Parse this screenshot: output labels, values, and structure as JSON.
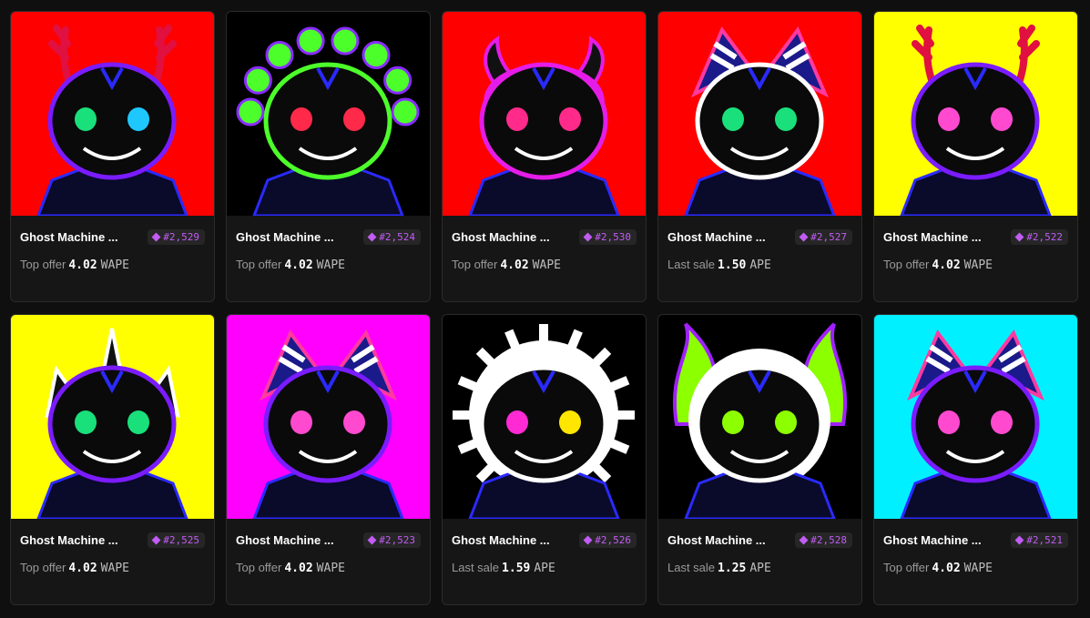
{
  "cards": [
    {
      "name": "Ghost Machine ...",
      "token": "#2,529",
      "label": "Top offer",
      "price": "4.02",
      "currency": "WAPE",
      "bg": "#ff0000",
      "eye": "#19e07a",
      "eye2": "#1ec8ff",
      "accent": "#7a1cff",
      "horn": "antlers"
    },
    {
      "name": "Ghost Machine ...",
      "token": "#2,524",
      "label": "Top offer",
      "price": "4.02",
      "currency": "WAPE",
      "bg": "#000000",
      "eye": "#ff2a4a",
      "eye2": "#ff2a4a",
      "accent": "#4dff2a",
      "horn": "tendrils"
    },
    {
      "name": "Ghost Machine ...",
      "token": "#2,530",
      "label": "Top offer",
      "price": "4.02",
      "currency": "WAPE",
      "bg": "#ff0000",
      "eye": "#ff2a8a",
      "eye2": "#ff2a8a",
      "accent": "#e51ce8",
      "horn": "horns"
    },
    {
      "name": "Ghost Machine ...",
      "token": "#2,527",
      "label": "Last sale",
      "price": "1.50",
      "currency": "APE",
      "bg": "#ff0000",
      "eye": "#19e07a",
      "eye2": "#19e07a",
      "accent": "#ffffff",
      "horn": "fins"
    },
    {
      "name": "Ghost Machine ...",
      "token": "#2,522",
      "label": "Top offer",
      "price": "4.02",
      "currency": "WAPE",
      "bg": "#ffff00",
      "eye": "#ff4ad0",
      "eye2": "#ff4ad0",
      "accent": "#7a1cff",
      "horn": "antlers"
    },
    {
      "name": "Ghost Machine ...",
      "token": "#2,525",
      "label": "Top offer",
      "price": "4.02",
      "currency": "WAPE",
      "bg": "#ffff00",
      "eye": "#19e07a",
      "eye2": "#19e07a",
      "accent": "#7a1cff",
      "horn": "spikes"
    },
    {
      "name": "Ghost Machine ...",
      "token": "#2,523",
      "label": "Top offer",
      "price": "4.02",
      "currency": "WAPE",
      "bg": "#ff00ff",
      "eye": "#ff4ad0",
      "eye2": "#ff4ad0",
      "accent": "#7a1cff",
      "horn": "fins"
    },
    {
      "name": "Ghost Machine ...",
      "token": "#2,526",
      "label": "Last sale",
      "price": "1.59",
      "currency": "APE",
      "bg": "#000000",
      "eye": "#ff2ad4",
      "eye2": "#ffe600",
      "accent": "#ffffff",
      "horn": "halo"
    },
    {
      "name": "Ghost Machine ...",
      "token": "#2,528",
      "label": "Last sale",
      "price": "1.25",
      "currency": "APE",
      "bg": "#000000",
      "eye": "#8cff00",
      "eye2": "#8cff00",
      "accent": "#ffffff",
      "horn": "flames"
    },
    {
      "name": "Ghost Machine ...",
      "token": "#2,521",
      "label": "Top offer",
      "price": "4.02",
      "currency": "WAPE",
      "bg": "#00f0ff",
      "eye": "#ff4ad0",
      "eye2": "#ff4ad0",
      "accent": "#7a1cff",
      "horn": "fins"
    }
  ]
}
